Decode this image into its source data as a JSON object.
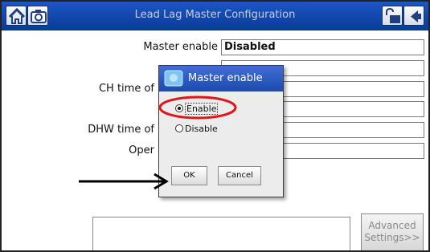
{
  "window": {
    "title": "Lead Lag Master Configuration"
  },
  "form": {
    "rows": [
      {
        "label": "Master enable",
        "value": "Disabled"
      },
      {
        "label": "",
        "value": ""
      },
      {
        "label": "CH time of",
        "value": ""
      },
      {
        "label": "",
        "value": ""
      },
      {
        "label": "DHW time of",
        "value": ""
      },
      {
        "label": "Oper",
        "value": ""
      }
    ]
  },
  "dialog": {
    "title": "Master enable",
    "options": [
      {
        "label": "Enable",
        "selected": true
      },
      {
        "label": "Disable",
        "selected": false
      }
    ],
    "ok_label": "OK",
    "cancel_label": "Cancel"
  },
  "footer": {
    "advanced_line1": "Advanced",
    "advanced_line2": "Settings>>"
  },
  "colors": {
    "titlebar": "#0a3fa0",
    "dialog_title": "#2a57bb",
    "highlight_circle": "#e0161b",
    "arrow": "#000000"
  },
  "icons": {
    "home": "home-icon",
    "camera": "camera-icon",
    "lock": "unlock-icon",
    "back": "back-arrow-icon"
  }
}
